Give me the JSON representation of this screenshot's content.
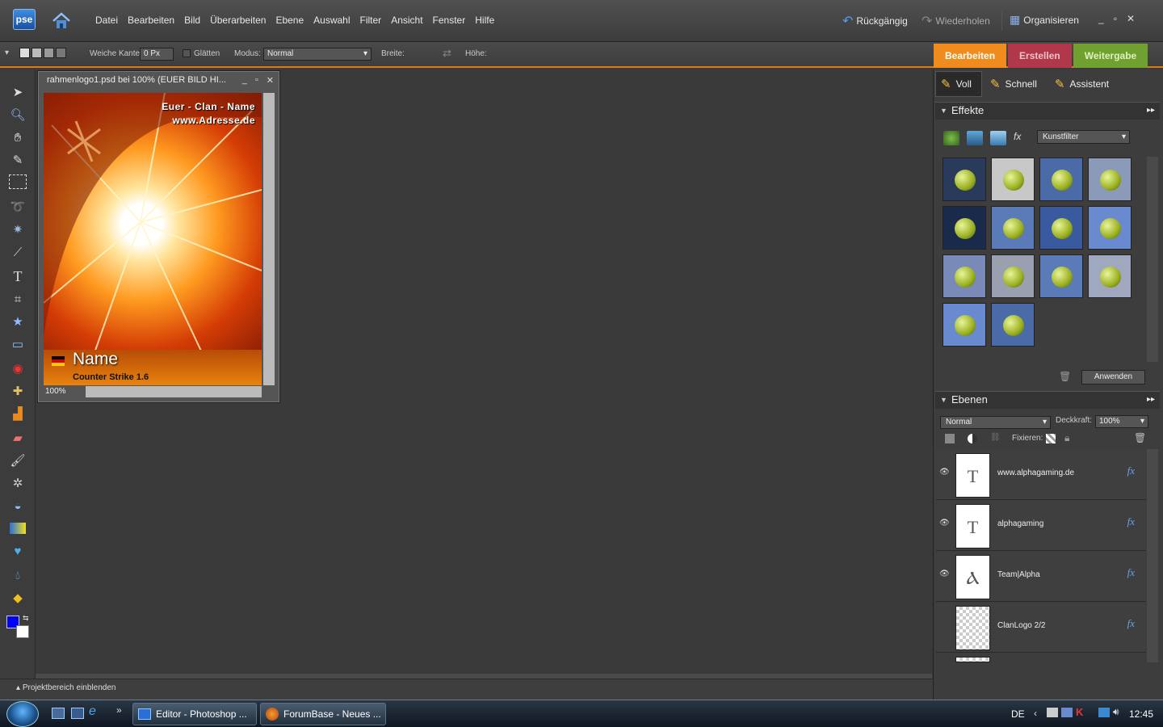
{
  "app": {
    "logo_text": "pse",
    "menu": [
      "Datei",
      "Bearbeiten",
      "Bild",
      "Überarbeiten",
      "Ebene",
      "Auswahl",
      "Filter",
      "Ansicht",
      "Fenster",
      "Hilfe"
    ],
    "undo_label": "Rückgängig",
    "redo_label": "Wiederholen",
    "organize_label": "Organisieren"
  },
  "options": {
    "feather_label": "Weiche Kante:",
    "feather_value": "0 Px",
    "smooth_label": "Glätten",
    "mode_label": "Modus:",
    "mode_value": "Normal",
    "width_label": "Breite:",
    "height_label": "Höhe:"
  },
  "mode_tabs": [
    {
      "label": "Bearbeiten",
      "color": "#f08c1e"
    },
    {
      "label": "Erstellen",
      "color": "#b0384a"
    },
    {
      "label": "Weitergabe",
      "color": "#6fa030"
    }
  ],
  "document": {
    "title": "rahmenlogo1.psd bei 100% (EUER BILD HI...",
    "zoom": "100%",
    "canvas_line1": "Euer - Clan - Name",
    "canvas_line2": "www.Adresse.de",
    "canvas_name": "Name",
    "canvas_sub": "Counter Strike 1.6"
  },
  "view_buttons": [
    "Voll",
    "Schnell",
    "Assistent"
  ],
  "effects": {
    "title": "Effekte",
    "category": "Kunstfilter",
    "apply_label": "Anwenden",
    "thumbnails": 14
  },
  "layers": {
    "title": "Ebenen",
    "blend_mode": "Normal",
    "opacity_label": "Deckkraft:",
    "opacity_value": "100%",
    "lock_label": "Fixieren:",
    "items": [
      {
        "name": "www.alphagaming.de",
        "thumb": "T",
        "visible": true
      },
      {
        "name": "alphagaming",
        "thumb": "T",
        "visible": true
      },
      {
        "name": "Team|Alpha",
        "thumb": "Ⲁ",
        "visible": true
      },
      {
        "name": "ClanLogo 2/2",
        "thumb": "",
        "visible": false
      }
    ]
  },
  "bottom": {
    "project_bin_label": "Projektbereich einblenden"
  },
  "taskbar": {
    "buttons": [
      "Editor - Photoshop ...",
      "ForumBase - Neues ..."
    ],
    "language": "DE",
    "clock": "12:45"
  }
}
